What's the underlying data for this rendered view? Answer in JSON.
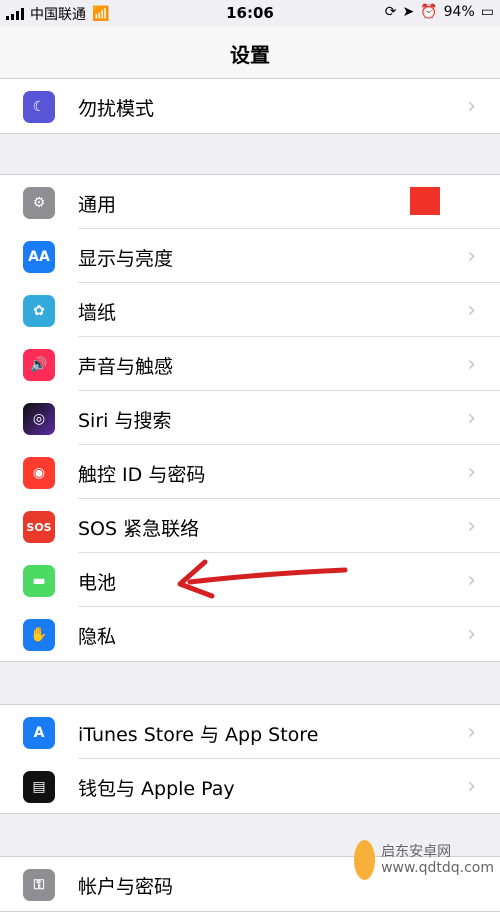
{
  "status": {
    "carrier": "中国联通",
    "time": "16:06",
    "battery": "94%"
  },
  "nav": {
    "title": "设置"
  },
  "groups": [
    [
      {
        "label": "勿扰模式",
        "icon": "moon-icon",
        "color": "#5856d6"
      }
    ],
    [
      {
        "label": "通用",
        "icon": "gear-icon",
        "color": "#8e8e93"
      },
      {
        "label": "显示与亮度",
        "icon": "aa-icon",
        "color": "#1a7cf5"
      },
      {
        "label": "墙纸",
        "icon": "flower-icon",
        "color": "#34aadc"
      },
      {
        "label": "声音与触感",
        "icon": "speaker-icon",
        "color": "#ff2d55"
      },
      {
        "label": "Siri 与搜索",
        "icon": "siri-icon",
        "color": "#222"
      },
      {
        "label": "触控 ID 与密码",
        "icon": "fingerprint-icon",
        "color": "#ff3b30"
      },
      {
        "label": "SOS 紧急联络",
        "icon": "sos-icon",
        "color": "#e8392b"
      },
      {
        "label": "电池",
        "icon": "battery-icon",
        "color": "#4cd964"
      },
      {
        "label": "隐私",
        "icon": "hand-icon",
        "color": "#1a7cf5"
      }
    ],
    [
      {
        "label": "iTunes Store 与 App Store",
        "icon": "appstore-icon",
        "color": "#1a7cf5"
      },
      {
        "label": "钱包与 Apple Pay",
        "icon": "wallet-icon",
        "color": "#111"
      }
    ],
    [
      {
        "label": "帐户与密码",
        "icon": "key-icon",
        "color": "#8e8e93"
      }
    ]
  ],
  "watermark": {
    "site1": "启东安卓网",
    "site2": "www.qdtdq.com"
  }
}
